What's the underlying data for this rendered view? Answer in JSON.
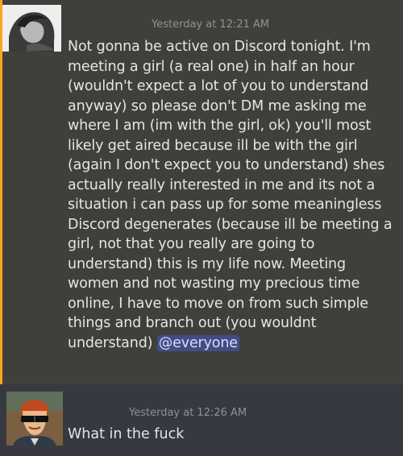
{
  "messages": [
    {
      "timestamp": "Yesterday at 12:21 AM",
      "text": "Not gonna be active on Discord tonight. I'm meeting a girl (a real one) in half an hour (wouldn't expect a lot of you to understand anyway) so please don't DM me asking me where I am (im with the girl, ok) you'll most likely get aired because ill be with the girl (again I don't expect you to understand) shes actually really interested in me and its not a situation i can pass up for some meaningless Discord degenerates (because ill be meeting a girl, not that you really are going to understand) this is my life now. Meeting women and not wasting my precious time online, I have to move on from such simple things and branch out (you wouldnt understand)",
      "mention": "@everyone"
    },
    {
      "timestamp": "Yesterday at 12:26 AM",
      "text": "What in the fuck"
    }
  ],
  "colors": {
    "accent": "#f5a623",
    "mention_bg": "#424c84"
  },
  "icons": {
    "avatar1": "user-avatar-woman-photo-icon",
    "avatar2": "user-avatar-cartoon-man-sunglasses-icon"
  }
}
